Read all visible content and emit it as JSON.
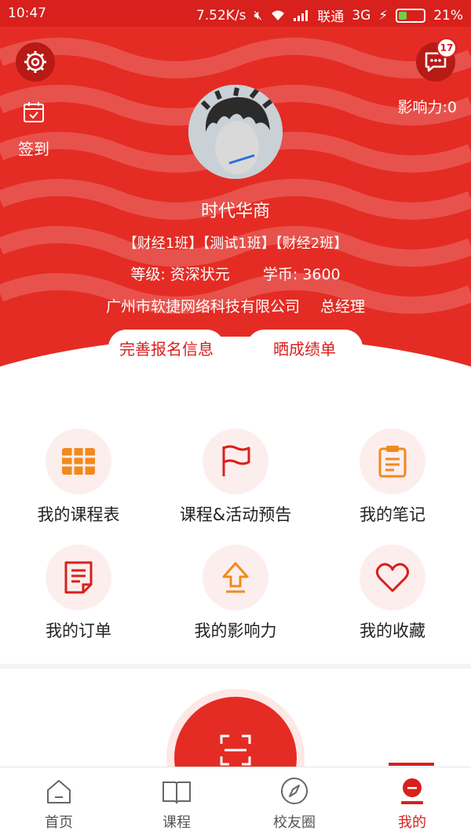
{
  "statusbar": {
    "time": "10:47",
    "speed": "7.52K/s",
    "carrier": "联通",
    "network": "3G",
    "battery": "21%"
  },
  "header": {
    "signin_label": "签到",
    "influence": "影响力:0",
    "message_count": "17",
    "name": "时代华商",
    "classes": "【财经1班】【测试1班】【财经2班】",
    "level": "等级: 资深状元",
    "coins": "学币: 3600",
    "company": "广州市软捷网络科技有限公司",
    "position": "总经理",
    "btn_complete": "完善报名信息",
    "btn_share": "晒成绩单"
  },
  "grid": [
    {
      "label": "我的课程表",
      "icon": "calendar-grid-icon"
    },
    {
      "label": "课程&活动预告",
      "icon": "flag-icon"
    },
    {
      "label": "我的笔记",
      "icon": "clipboard-icon"
    },
    {
      "label": "我的订单",
      "icon": "document-icon"
    },
    {
      "label": "我的影响力",
      "icon": "arrow-up-icon"
    },
    {
      "label": "我的收藏",
      "icon": "heart-icon"
    }
  ],
  "tabs": [
    {
      "label": "首页",
      "icon": "home-icon"
    },
    {
      "label": "课程",
      "icon": "book-icon"
    },
    {
      "label": "校友圈",
      "icon": "compass-icon"
    },
    {
      "label": "我的",
      "icon": "profile-icon",
      "active": true
    }
  ],
  "colors": {
    "brand": "#d8201c",
    "header": "#e42c24",
    "icon_orange": "#f08a1c"
  }
}
